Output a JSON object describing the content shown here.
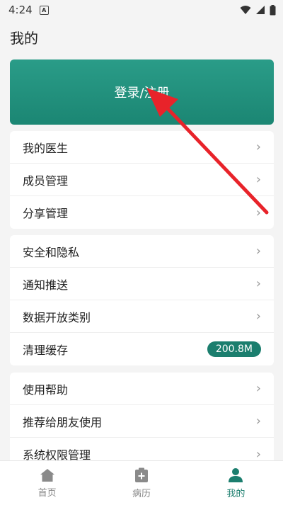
{
  "status": {
    "time": "4:24",
    "notif_glyph": "A"
  },
  "page": {
    "title": "我的"
  },
  "login": {
    "label": "登录/注册"
  },
  "card1": [
    {
      "label": "我的医生",
      "icon": "chevron-right-icon"
    },
    {
      "label": "成员管理",
      "icon": "chevron-right-icon"
    },
    {
      "label": "分享管理",
      "icon": "chevron-right-icon"
    }
  ],
  "card2": [
    {
      "label": "安全和隐私",
      "icon": "chevron-right-icon"
    },
    {
      "label": "通知推送",
      "icon": "chevron-right-icon"
    },
    {
      "label": "数据开放类别",
      "icon": "chevron-right-icon"
    },
    {
      "label": "清理缓存",
      "badge": "200.8M"
    }
  ],
  "card3": [
    {
      "label": "使用帮助",
      "icon": "chevron-right-icon"
    },
    {
      "label": "推荐给朋友使用",
      "icon": "chevron-right-icon"
    },
    {
      "label": "系统权限管理",
      "icon": "chevron-right-icon"
    }
  ],
  "nav": [
    {
      "label": "首页",
      "icon": "home-icon"
    },
    {
      "label": "病历",
      "icon": "medical-record-icon"
    },
    {
      "label": "我的",
      "icon": "person-icon",
      "active": true
    }
  ],
  "colors": {
    "accent": "#1b7e6e",
    "arrow": "#e8232a"
  }
}
